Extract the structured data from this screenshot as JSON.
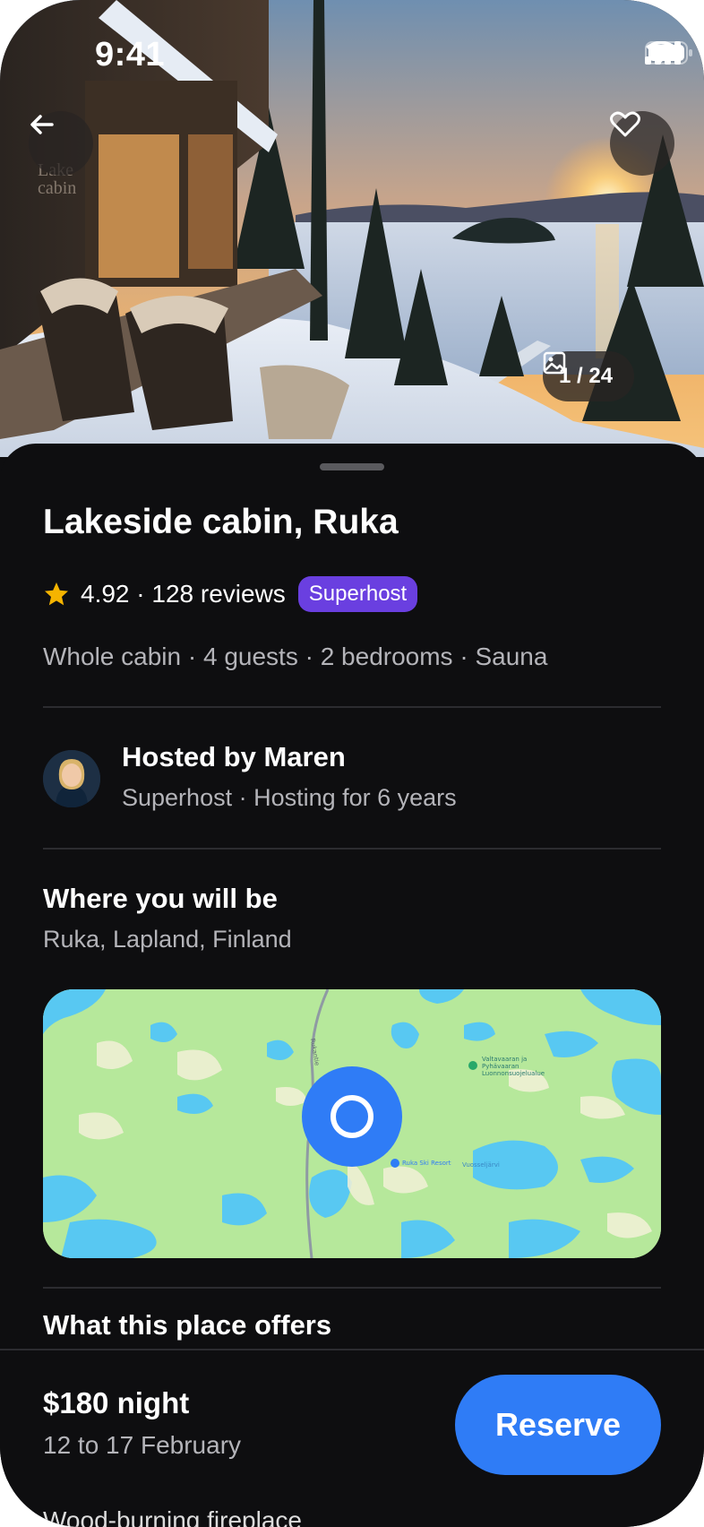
{
  "status_bar": {
    "time": "9:41",
    "icons": [
      "signal-icon",
      "wifi-icon",
      "battery-icon"
    ]
  },
  "hero": {
    "photo_counter": "1 / 24",
    "sign_text": "Lake cabin",
    "icons": {
      "back": "arrow-left-icon",
      "favorite": "heart-icon",
      "gallery": "image-icon"
    }
  },
  "listing": {
    "title": "Lakeside cabin, Ruka",
    "rating_text": "4.92 · 128 reviews",
    "badge": "Superhost",
    "details": "Whole cabin · 4 guests · 2 bedrooms · Sauna"
  },
  "host": {
    "name": "Hosted by Maren",
    "subtitle": "Superhost · Hosting for 6 years"
  },
  "location": {
    "title": "Where you will be",
    "subtitle": "Ruka, Lapland, Finland",
    "map_labels": {
      "park": "Valtavaaran ja Pyhävaaran Luonnonsuojelualue",
      "resort": "Ruka Ski Resort",
      "lake": "Vuosseljärvi",
      "road": "Rukantie"
    }
  },
  "offers": {
    "title": "What this place offers",
    "first_item": "Wood-burning fireplace"
  },
  "booking": {
    "price": "$180 night",
    "dates": "12 to 17 February",
    "reserve_label": "Reserve"
  },
  "colors": {
    "accent_blue": "#2f7cf6",
    "superhost_purple": "#6a3fe0",
    "sheet_bg": "#0e0e10",
    "star": "#f5b400",
    "map_green": "#b6e89b",
    "map_water": "#58c8f2"
  }
}
